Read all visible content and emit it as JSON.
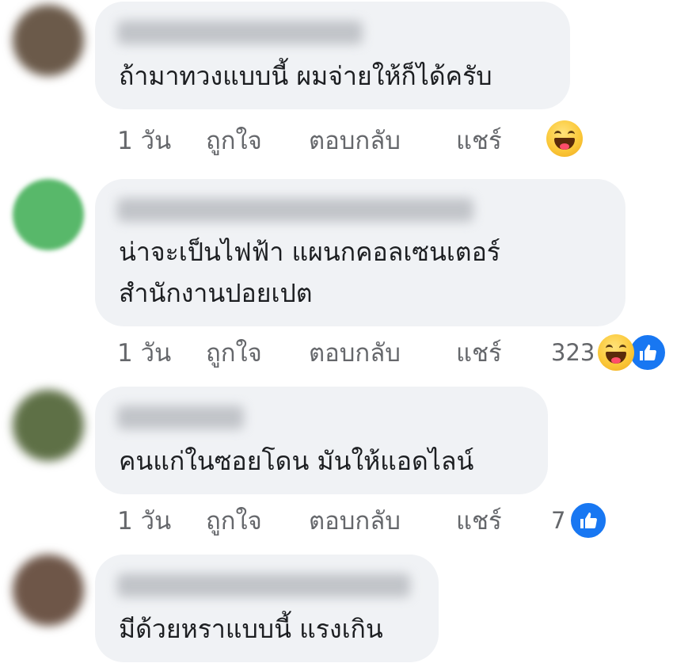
{
  "comments": [
    {
      "text_lines": [
        "ถ้ามาทวงแบบนี้ ผมจ่ายให้ก็ได้ครับ"
      ],
      "time": "1 วัน",
      "like": "ถูกใจ",
      "reply": "ตอบกลับ",
      "share": "แชร์",
      "reaction_count": "",
      "reactions": [
        "haha-icon"
      ],
      "avatar_color": "#6b5a4a"
    },
    {
      "text_lines": [
        "น่าจะเป็นไฟฟ้า แผนกคอลเซนเตอร์",
        "สำนักงานปอยเปต"
      ],
      "time": "1 วัน",
      "like": "ถูกใจ",
      "reply": "ตอบกลับ",
      "share": "แชร์",
      "reaction_count": "323",
      "reactions": [
        "haha-icon",
        "like-icon"
      ],
      "avatar_color": "#58b86a"
    },
    {
      "text_lines": [
        "คนแก่ในซอยโดน มันให้แอดไลน์"
      ],
      "time": "1 วัน",
      "like": "ถูกใจ",
      "reply": "ตอบกลับ",
      "share": "แชร์",
      "reaction_count": "7",
      "reactions": [
        "like-icon"
      ],
      "avatar_color": "#5e7046"
    },
    {
      "text_lines": [
        "มีด้วยหราแบบนี้ แรงเกิน"
      ],
      "time": "",
      "like": "",
      "reply": "",
      "share": "",
      "reaction_count": "",
      "reactions": [],
      "avatar_color": "#6e5648"
    }
  ],
  "colors": {
    "bubble": "#f0f2f5",
    "text": "#1c1e21",
    "meta": "#65676b",
    "like_blue": "#1877f2"
  }
}
